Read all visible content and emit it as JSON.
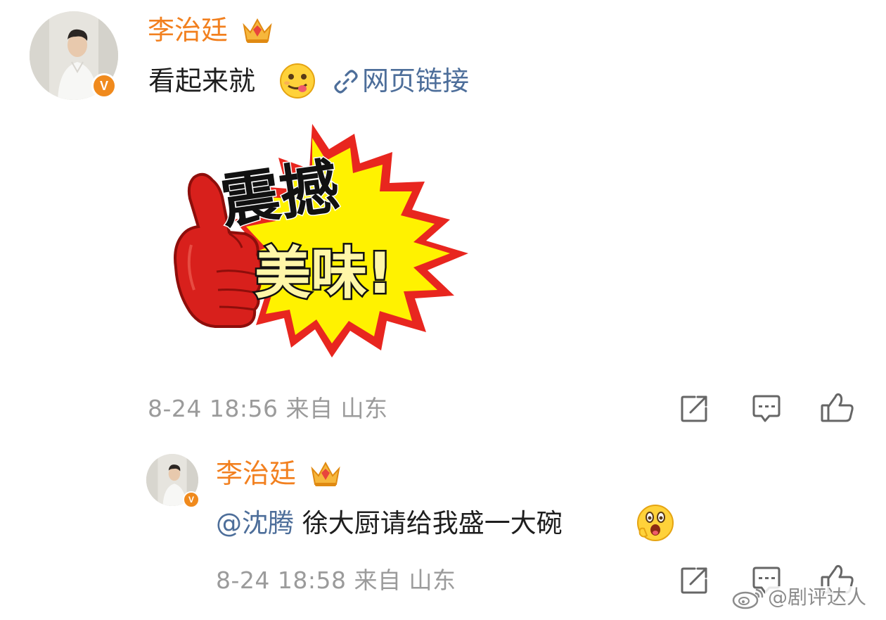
{
  "comment": {
    "username": "李治廷",
    "text": "看起来就",
    "link_text": "网页链接",
    "sticker": {
      "line1": "震撼",
      "line2": "美味!"
    },
    "date": "8-24",
    "time": "18:56",
    "source": "来自 山东"
  },
  "reply": {
    "username": "李治廷",
    "mention": "@沈腾",
    "text": "徐大厨请给我盛一大碗",
    "date": "8-24",
    "time": "18:58",
    "source": "来自 山东"
  },
  "badge": {
    "verified_letter": "V"
  },
  "watermark": "@剧评达人",
  "colors": {
    "username": "#f2801f",
    "link": "#4d6e9a",
    "meta": "#9b9b9b",
    "verified": "#f08a1d"
  },
  "icons": [
    "verified-icon",
    "crown-icon",
    "yum-emoji-icon",
    "link-icon",
    "share-icon",
    "comment-icon",
    "like-icon",
    "surprised-emoji-icon",
    "weibo-logo-icon"
  ]
}
